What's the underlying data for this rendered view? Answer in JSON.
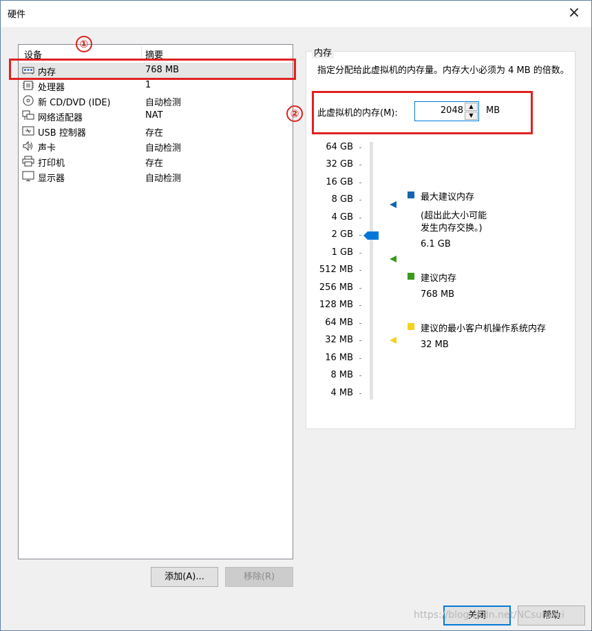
{
  "window": {
    "title": "硬件",
    "close_glyph": "×"
  },
  "device_list": {
    "headers": {
      "device": "设备",
      "summary": "摘要"
    },
    "items": [
      {
        "icon": "memory-icon",
        "name": "内存",
        "summary": "768 MB",
        "selected": true
      },
      {
        "icon": "processor-icon",
        "name": "处理器",
        "summary": "1"
      },
      {
        "icon": "cd-icon",
        "name": "新 CD/DVD (IDE)",
        "summary": "自动检测"
      },
      {
        "icon": "network-icon",
        "name": "网络适配器",
        "summary": "NAT"
      },
      {
        "icon": "usb-icon",
        "name": "USB 控制器",
        "summary": "存在"
      },
      {
        "icon": "sound-icon",
        "name": "声卡",
        "summary": "自动检测"
      },
      {
        "icon": "printer-icon",
        "name": "打印机",
        "summary": "存在"
      },
      {
        "icon": "display-icon",
        "name": "显示器",
        "summary": "自动检测"
      }
    ]
  },
  "buttons": {
    "add": "添加(A)...",
    "remove": "移除(R)",
    "close": "关闭",
    "help": "帮助"
  },
  "memory": {
    "group_label": "内存",
    "description": "指定分配给此虚拟机的内存量。内存大小必须为 4 MB 的倍数。",
    "field_label": "此虚拟机的内存(M):",
    "value": "2048",
    "unit": "MB",
    "scale": [
      "64 GB",
      "32 GB",
      "16 GB",
      "8 GB",
      "4 GB",
      "2 GB",
      "1 GB",
      "512 MB",
      "256 MB",
      "128 MB",
      "64 MB",
      "32 MB",
      "16 MB",
      "8 MB",
      "4 MB"
    ],
    "legend": {
      "max": {
        "title": "最大建议内存",
        "note1": "(超出此大小可能",
        "note2": "发生内存交换。)",
        "value": "6.1 GB",
        "color": "#1565b0"
      },
      "recommended": {
        "title": "建议内存",
        "value": "768 MB",
        "color": "#3a9a1e"
      },
      "min": {
        "title": "建议的最小客户机操作系统内存",
        "value": "32 MB",
        "color": "#f2d21a"
      }
    }
  },
  "annotations": {
    "one": "①",
    "two": "②"
  },
  "watermark": "https://blog.csdn.net/NCsunwei"
}
